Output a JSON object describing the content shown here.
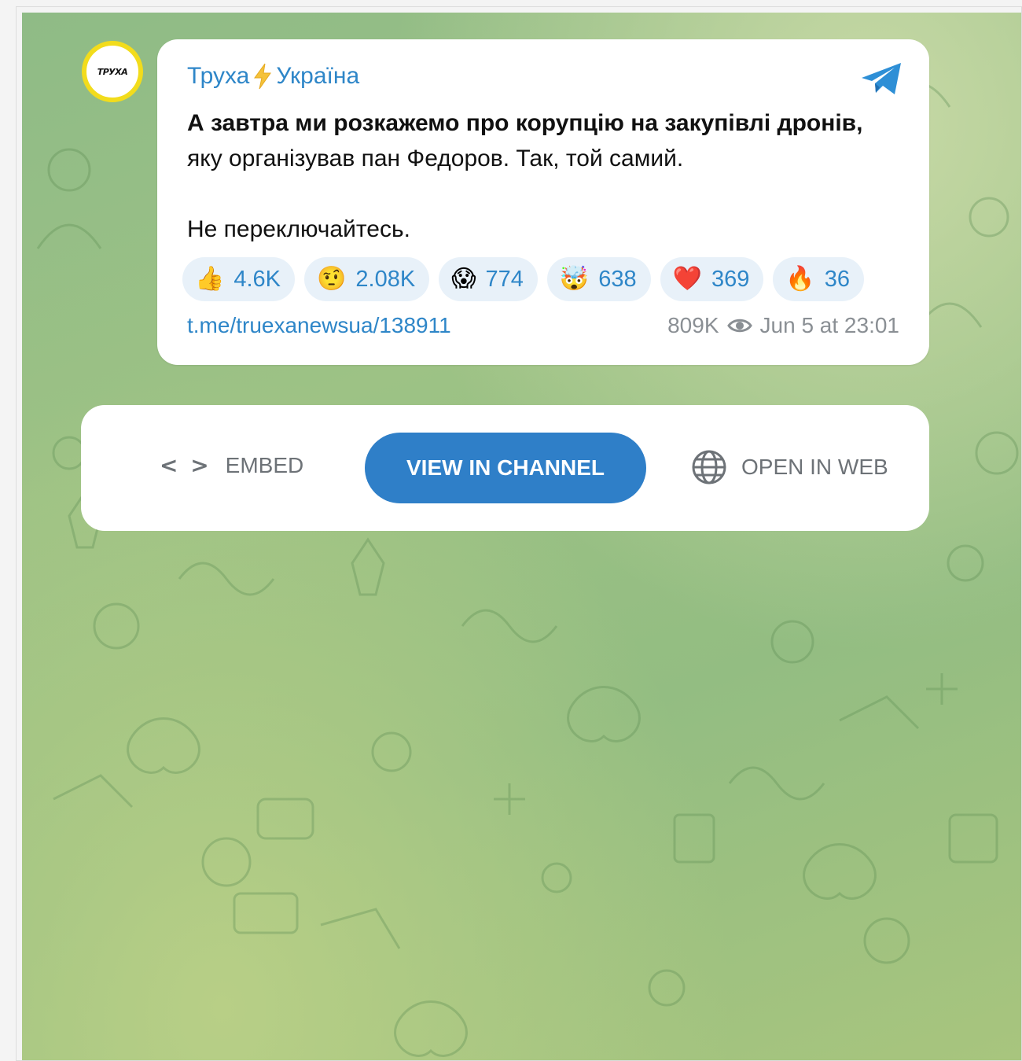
{
  "post": {
    "channel_name_left": "Труха",
    "channel_name_right": "Україна",
    "avatar_text": "ТРУХА",
    "text_bold": "А завтра ми розкажемо про корупцію на закупівлі дронів,",
    "text_regular": " яку організував пан Федоров. Так, той самий.",
    "text_second": "Не переключайтесь.",
    "reactions": [
      {
        "emoji": "👍",
        "count": "4.6K"
      },
      {
        "emoji": "🤨",
        "count": "2.08K"
      },
      {
        "emoji": "😱",
        "count": "774"
      },
      {
        "emoji": "🤯",
        "count": "638"
      },
      {
        "emoji": "❤️",
        "count": "369"
      },
      {
        "emoji": "🔥",
        "count": "36"
      }
    ],
    "link": "t.me/truexanewsua/138911",
    "views": "809K",
    "date": "Jun 5 at 23:01"
  },
  "actions": {
    "embed_icon": "< >",
    "embed_label": "EMBED",
    "view_label": "VIEW IN CHANNEL",
    "open_web_label": "OPEN IN WEB"
  },
  "icons": {
    "telegram": "telegram-icon",
    "bolt": "lightning-icon",
    "eye": "eye-icon",
    "globe": "globe-icon",
    "code": "code-icon"
  },
  "colors": {
    "accent": "#2e86c8",
    "button": "#2f7fc8",
    "avatar_ring": "#f2dc1c",
    "background": "#9dc285"
  }
}
